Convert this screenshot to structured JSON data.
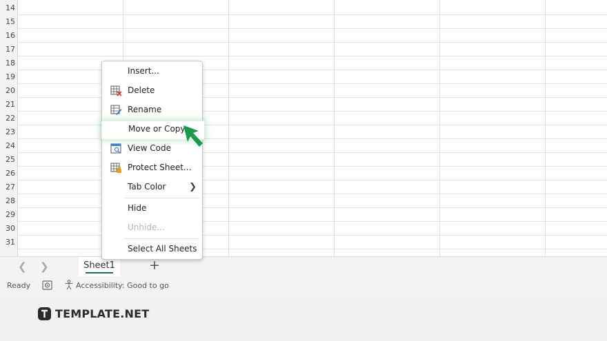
{
  "grid": {
    "rows": [
      "14",
      "15",
      "16",
      "17",
      "18",
      "19",
      "20",
      "21",
      "22",
      "23",
      "24",
      "25",
      "26",
      "27",
      "28",
      "29",
      "30",
      "31"
    ]
  },
  "context_menu": {
    "items": [
      {
        "label": "Insert...",
        "icon": "none"
      },
      {
        "label": "Delete",
        "icon": "delete-sheet-icon"
      },
      {
        "label": "Rename",
        "icon": "rename-sheet-icon"
      },
      {
        "label": "Move or Copy...",
        "icon": "none",
        "state": "highlighted"
      },
      {
        "label": "View Code",
        "icon": "view-code-icon"
      },
      {
        "label": "Protect Sheet...",
        "icon": "protect-sheet-icon"
      },
      {
        "label": "Tab Color",
        "icon": "none",
        "submenu": true
      },
      {
        "label": "Hide",
        "icon": "none"
      },
      {
        "label": "Unhide...",
        "icon": "none",
        "state": "disabled"
      },
      {
        "label": "Select All Sheets",
        "icon": "none"
      }
    ]
  },
  "sheet_tabs": {
    "tabs": [
      {
        "label": "Sheet1",
        "active": true
      }
    ],
    "add_label": "+"
  },
  "status_bar": {
    "ready": "Ready",
    "accessibility": "Accessibility: Good to go"
  },
  "branding": {
    "logo_text": "TEMPLATE.NET"
  },
  "colors": {
    "accent_green": "#1e7145",
    "pointer_green": "#1a9a4c",
    "highlight_glow": "#7ccd8c"
  }
}
